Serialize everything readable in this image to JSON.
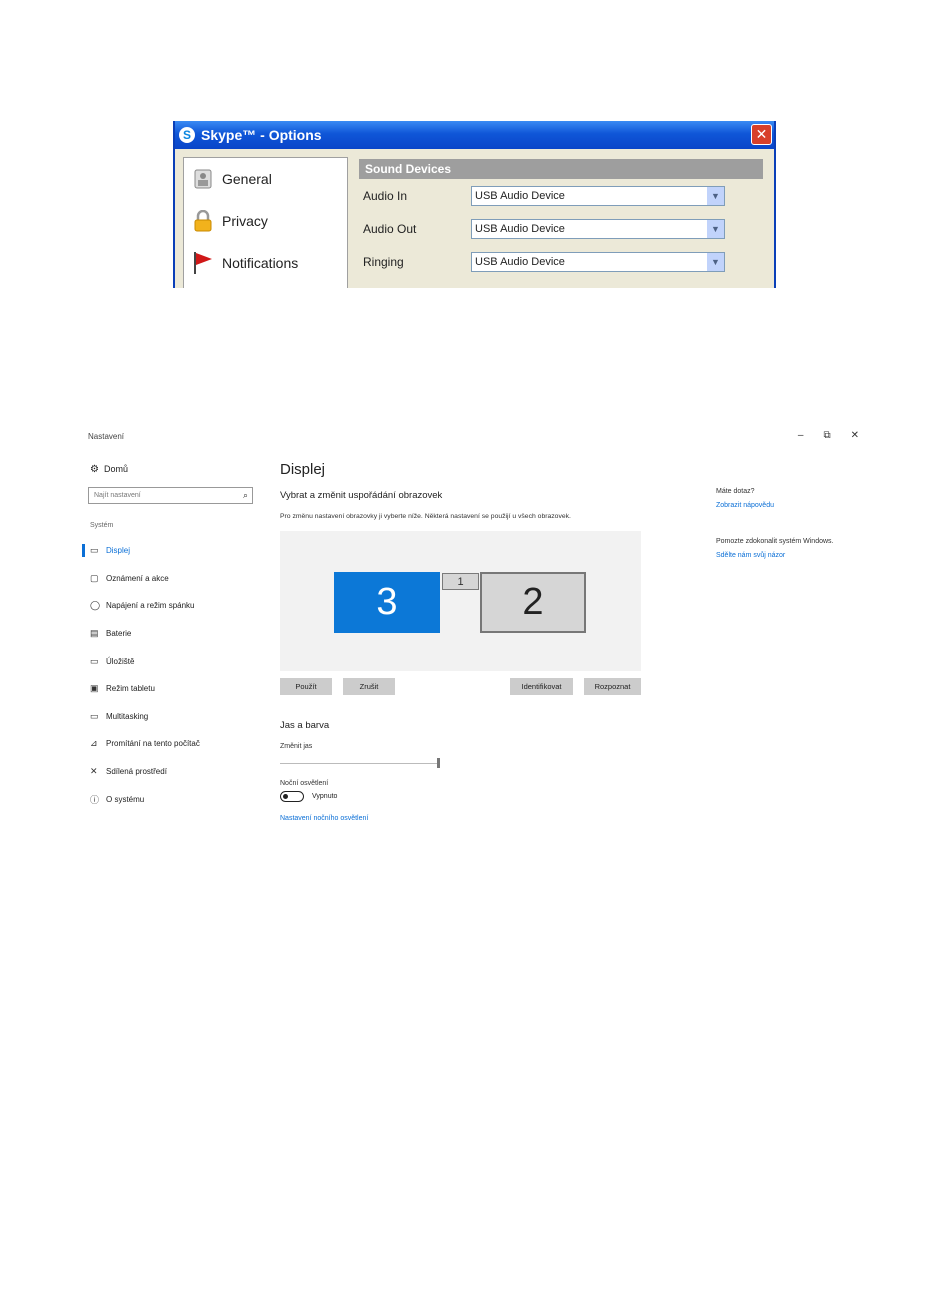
{
  "skype": {
    "title": "Skype™ - Options",
    "close_glyph": "✕",
    "nav": [
      {
        "label": "General",
        "icon": "general-icon"
      },
      {
        "label": "Privacy",
        "icon": "lock-icon"
      },
      {
        "label": "Notifications",
        "icon": "flag-icon"
      }
    ],
    "section_header": "Sound Devices",
    "rows": [
      {
        "label": "Audio In",
        "value": "USB Audio Device"
      },
      {
        "label": "Audio Out",
        "value": "USB Audio Device"
      },
      {
        "label": "Ringing",
        "value": "USB Audio Device"
      }
    ]
  },
  "settings": {
    "window_title": "Nastavení",
    "controls": {
      "minimize": "–",
      "restore": "⧉",
      "close": "✕"
    },
    "sidebar": {
      "home": "Domů",
      "search_placeholder": "Najít nastavení",
      "section": "Systém",
      "items": [
        {
          "label": "Displej",
          "icon": "display-icon",
          "glyph": "▭",
          "active": true
        },
        {
          "label": "Oznámení a akce",
          "icon": "notifications-icon",
          "glyph": "▢"
        },
        {
          "label": "Napájení a režim spánku",
          "icon": "power-icon",
          "glyph": "◯"
        },
        {
          "label": "Baterie",
          "icon": "battery-icon",
          "glyph": "▤"
        },
        {
          "label": "Úložiště",
          "icon": "storage-icon",
          "glyph": "▭"
        },
        {
          "label": "Režim tabletu",
          "icon": "tablet-icon",
          "glyph": "▣"
        },
        {
          "label": "Multitasking",
          "icon": "multitasking-icon",
          "glyph": "▭"
        },
        {
          "label": "Promítání na tento počítač",
          "icon": "projecting-icon",
          "glyph": "⊿"
        },
        {
          "label": "Sdílená prostředí",
          "icon": "shared-experiences-icon",
          "glyph": "✕"
        },
        {
          "label": "O systému",
          "icon": "about-icon",
          "glyph": "ⓘ"
        }
      ]
    },
    "main": {
      "title": "Displej",
      "subtitle": "Vybrat a změnit uspořádání obrazovek",
      "description": "Pro změnu nastavení obrazovky ji vyberte níže. Některá nastavení se použijí u všech obrazovek.",
      "monitors": [
        "3",
        "1",
        "2"
      ],
      "buttons": {
        "apply": "Použít",
        "cancel": "Zrušit",
        "identify": "Identifikovat",
        "detect": "Rozpoznat"
      },
      "brightness_section": "Jas a barva",
      "brightness_label": "Změnit jas",
      "brightness_level": 1.0,
      "night_light_label": "Noční osvětlení",
      "night_light_state": "Vypnuto",
      "night_light_link": "Nastavení nočního osvětlení"
    },
    "right": {
      "question": "Máte dotaz?",
      "help_link": "Zobrazit nápovědu",
      "improve": "Pomozte zdokonalit systém Windows.",
      "feedback_link": "Sdělte nám svůj názor"
    }
  }
}
